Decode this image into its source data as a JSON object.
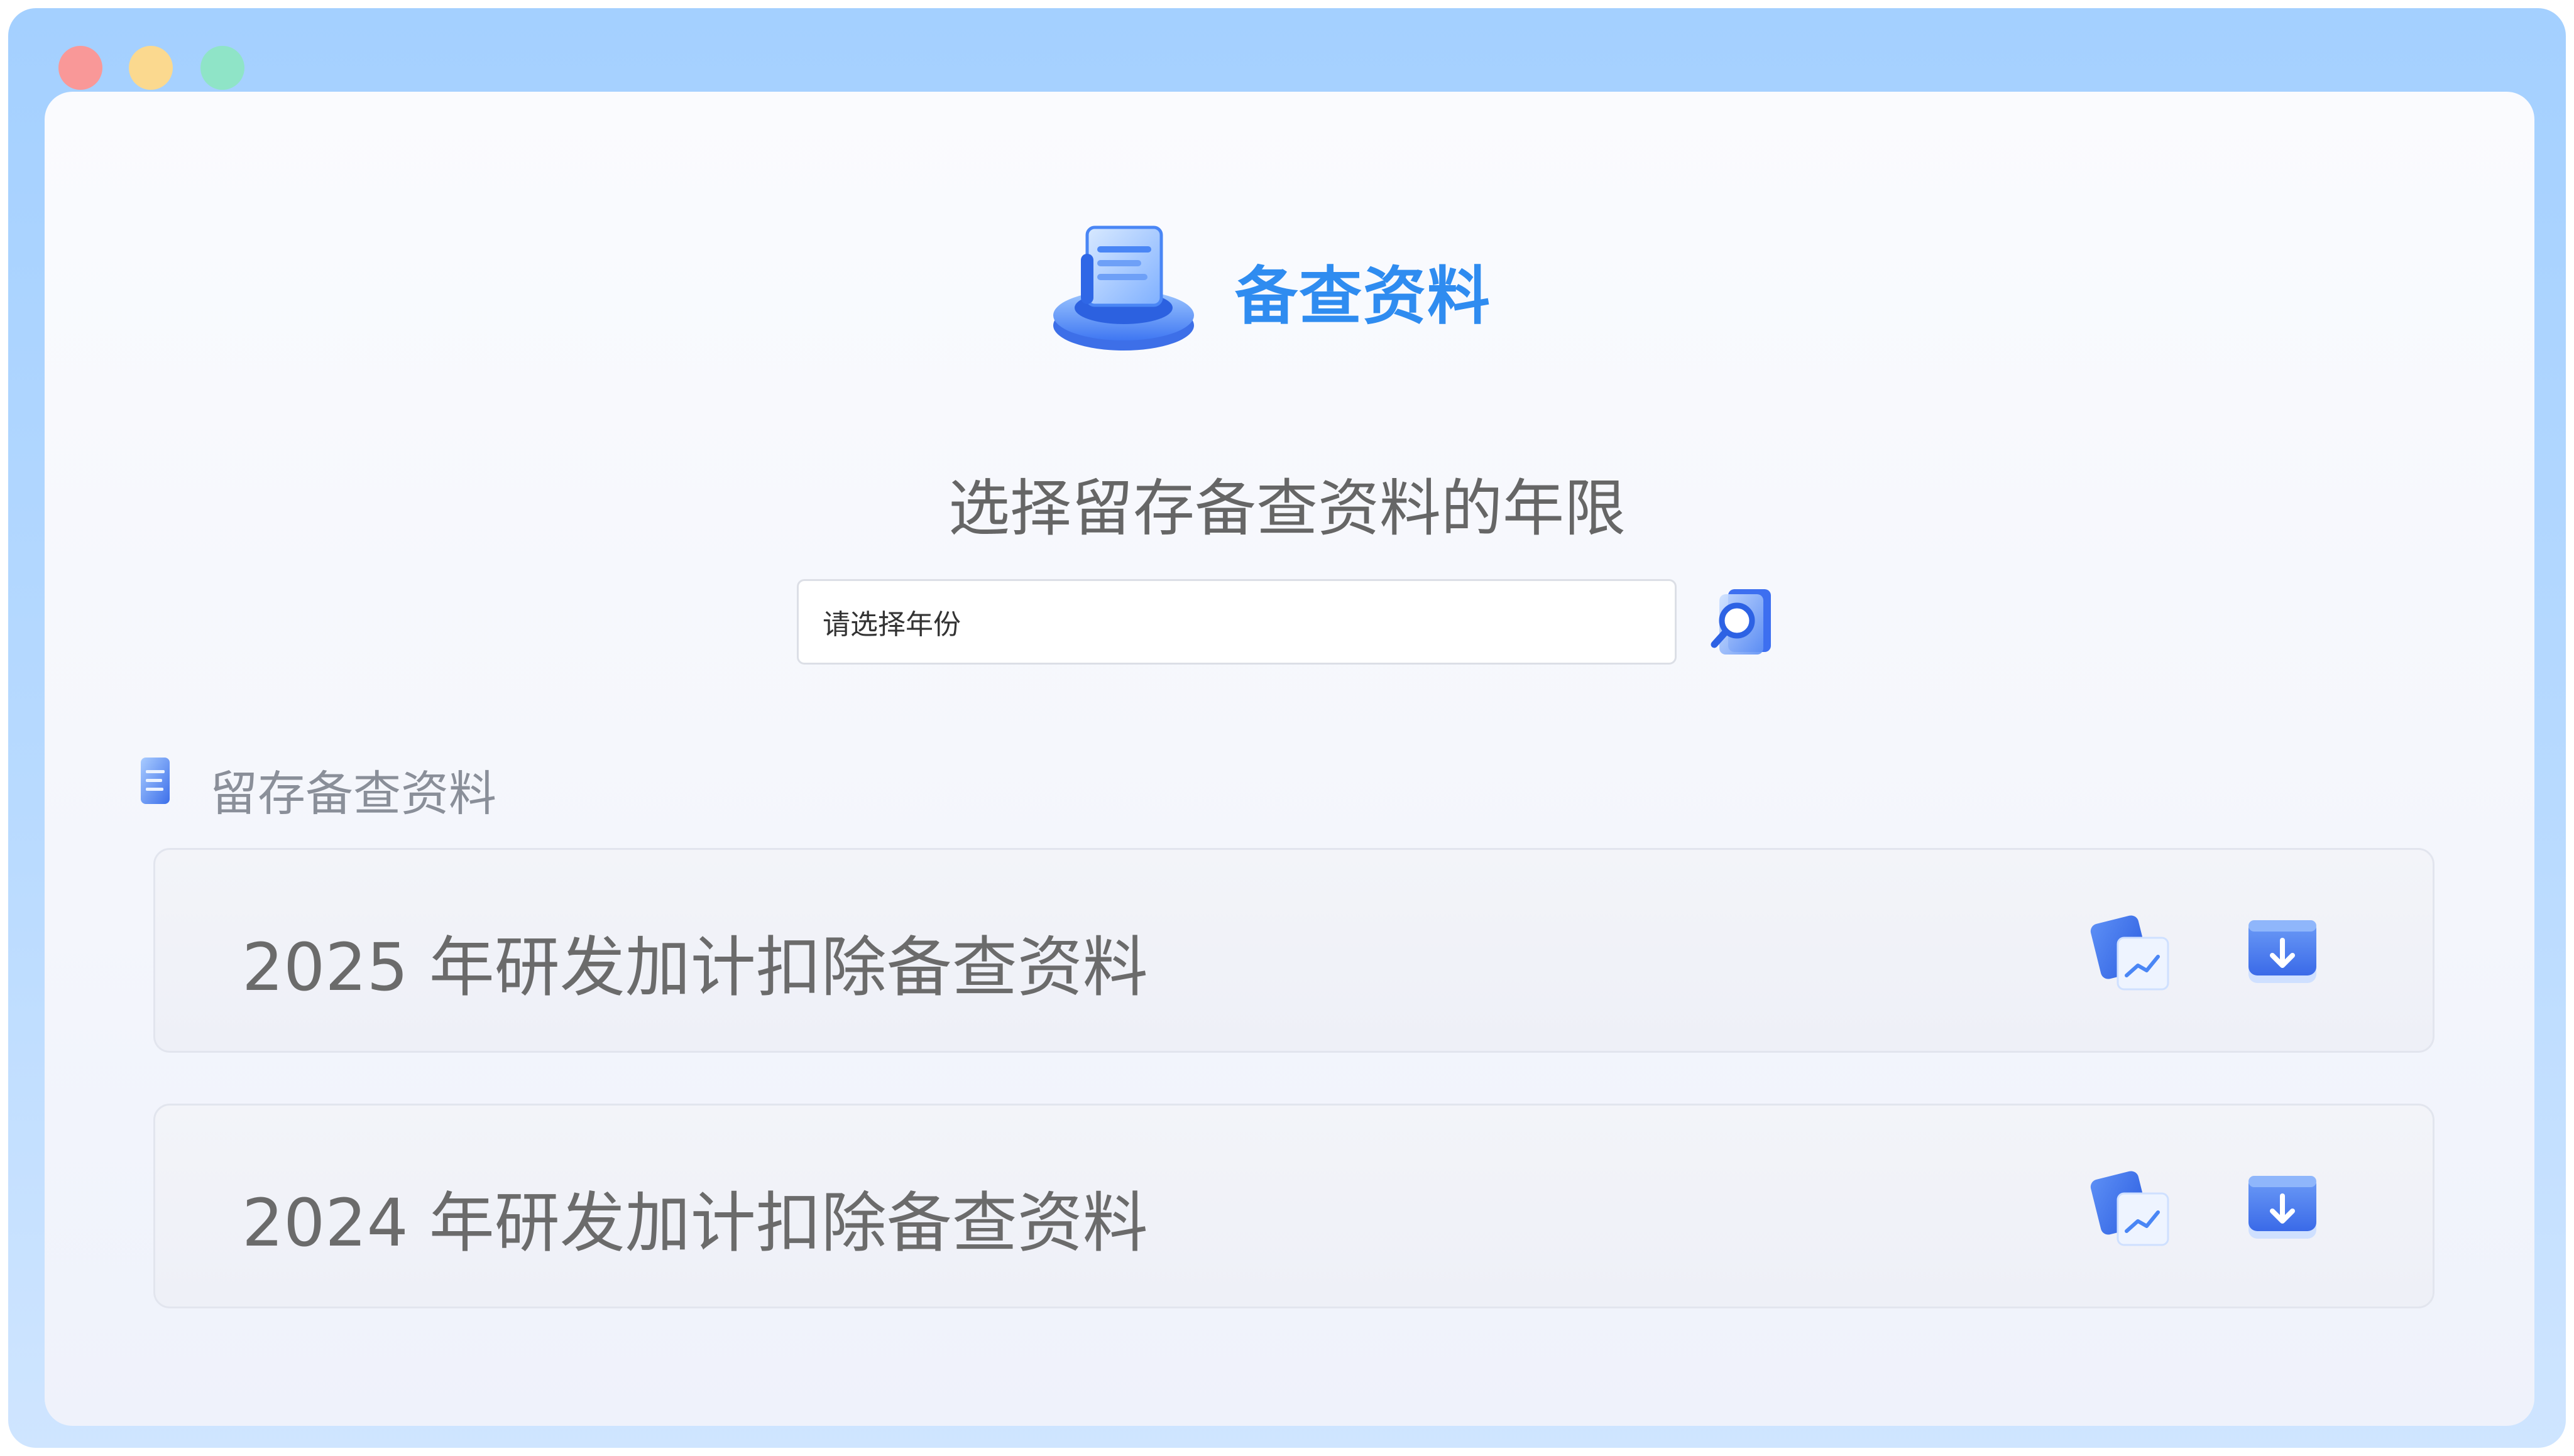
{
  "app": {
    "title": "备查资料",
    "logo_icon": "document-stack-icon"
  },
  "window_controls": [
    "close",
    "minimize",
    "maximize"
  ],
  "query": {
    "heading": "选择留存备查资料的年限",
    "year_select": {
      "placeholder": "请选择年份",
      "value": ""
    },
    "search_icon": "magnifier-icon"
  },
  "section": {
    "icon": "document-icon",
    "title": "留存备查资料"
  },
  "records": [
    {
      "title": "2025 年研发加计扣除备查资料",
      "actions": [
        "view-chart-icon",
        "download-icon"
      ]
    },
    {
      "title": "2024 年研发加计扣除备查资料",
      "actions": [
        "view-chart-icon",
        "download-icon"
      ]
    }
  ],
  "colors": {
    "frame": "#a4d0ff",
    "accent": "#2f8cf0",
    "icon_blue": "#3a6ff0",
    "text_gray": "#6b6b6b"
  }
}
